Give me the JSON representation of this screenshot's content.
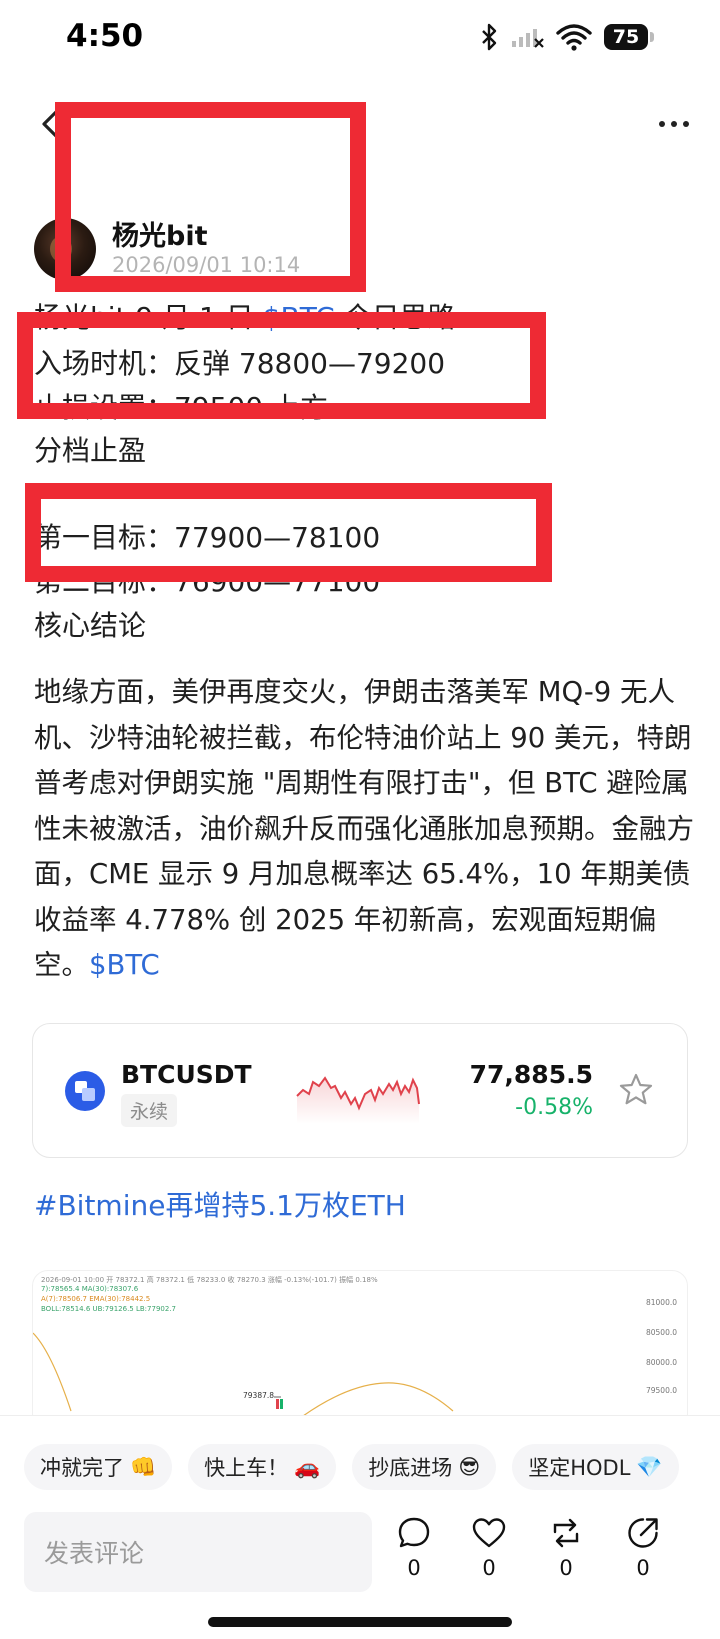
{
  "status_bar": {
    "time": "4:50",
    "battery": "75"
  },
  "author": {
    "name": "杨光bit",
    "time": "2026/09/01 10:14"
  },
  "post": {
    "line1_prefix": "杨光bit 9 月 1 日 ",
    "line1_link": "$BTC",
    "line1_suffix": " 今日思路",
    "entry": "入场时机：反弹 78800—79200",
    "stop": "止损设置：79500 上方",
    "tp_title": "分档止盈",
    "target1": "第一目标：77900—78100",
    "target2": "第二目标：76900—77100",
    "conclusion_title": "核心结论",
    "body": "地缘方面，美伊再度交火，伊朗击落美军 MQ-9 无人机、沙特油轮被拦截，布伦特油价站上 90 美元，特朗普考虑对伊朗实施 \"周期性有限打击\"，但 BTC 避险属性未被激活，油价飙升反而强化通胀加息预期。金融方面，CME 显示 9 月加息概率达 65.4%，10 年期美债收益率 4.778% 创 2025 年初新高，宏观面短期偏空。",
    "body_link": "$BTC"
  },
  "ticker": {
    "pair": "BTCUSDT",
    "tag": "永续",
    "price": "77,885.5",
    "change": "-0.58%",
    "change_color": "#17b26a",
    "sparkline_color": "#e0424c"
  },
  "hashtag": "#Bitmine再增持5.1万枚ETH",
  "chart_image": {
    "header": "2026-09-01 10:00  开 78372.1  高 78372.1  低 78233.0  收 78270.3  涨幅 -0.13%(-101.7)  振幅 0.18%",
    "ma_line": "7):78565.4   MA(30):78307.6",
    "ema_line": "A(7):78506.7   EMA(30):78442.5",
    "boll_line": "BOLL:78514.6   UB:79126.5   LB:77902.7",
    "y_axis": [
      "81000.0",
      "80500.0",
      "80000.0",
      "79500.0"
    ],
    "marker": "79387.8"
  },
  "quick_replies": [
    {
      "label": "冲就完了",
      "emoji": "👊"
    },
    {
      "label": "快上车！",
      "emoji": "🚗"
    },
    {
      "label": "抄底进场",
      "emoji": "😎"
    },
    {
      "label": "坚定HODL",
      "emoji": "💎"
    }
  ],
  "comment_placeholder": "发表评论",
  "actions": {
    "comments": "0",
    "likes": "0",
    "reposts": "0",
    "shares": "0"
  }
}
